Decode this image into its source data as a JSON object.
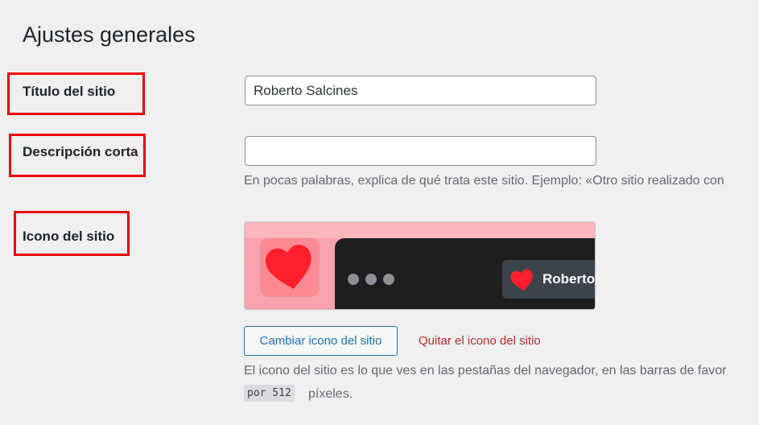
{
  "page": {
    "title": "Ajustes generales"
  },
  "fields": {
    "site_title": {
      "label": "Título del sitio",
      "value": "Roberto Salcines"
    },
    "tagline": {
      "label": "Descripción corta",
      "value": "",
      "description": "En pocas palabras, explica de qué trata este sitio. Ejemplo: «Otro sitio realizado con"
    },
    "site_icon": {
      "label": "Icono del sitio",
      "preview_tab_title": "Roberto Salci...",
      "change_button": "Cambiar icono del sitio",
      "remove_button": "Quitar el icono del sitio",
      "description_line1": "El icono del sitio es lo que ves en las pestañas del navegador, en las barras de favor",
      "description_code": "por 512",
      "description_line2": "píxeles."
    }
  },
  "colors": {
    "highlight": "#e8000b",
    "link": "#2271b1",
    "delete": "#b32d2e",
    "heart": "#ff1f2d"
  }
}
